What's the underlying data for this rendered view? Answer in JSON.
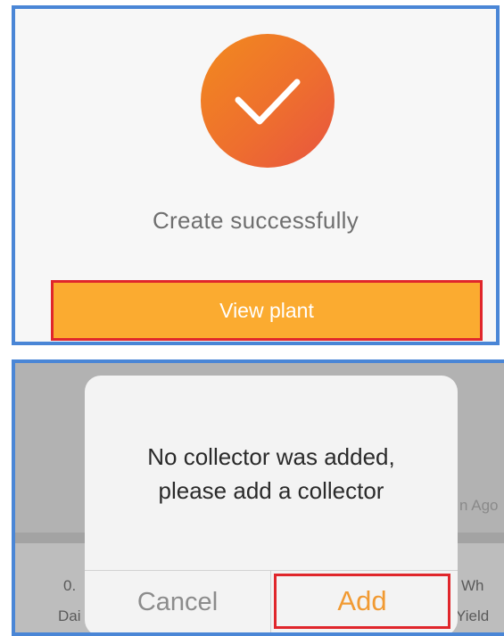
{
  "success_panel": {
    "message": "Create successfully",
    "view_plant_label": "View plant"
  },
  "dialog": {
    "message_line1": "No collector was added,",
    "message_line2": "please add a collector",
    "cancel_label": "Cancel",
    "add_label": "Add"
  },
  "background": {
    "time_fragment": "n Ago",
    "left_value_fragment": "0.",
    "left_label_fragment": "Dai",
    "right_unit_fragment": "Wh",
    "right_label_fragment": "Yield"
  },
  "colors": {
    "panel_border": "#4a86d6",
    "highlight_border": "#e0262b",
    "primary_button": "#fbab30",
    "check_circle": "#ee6f2e",
    "add_text": "#f19a32"
  },
  "icons": {
    "success": "checkmark-icon"
  }
}
